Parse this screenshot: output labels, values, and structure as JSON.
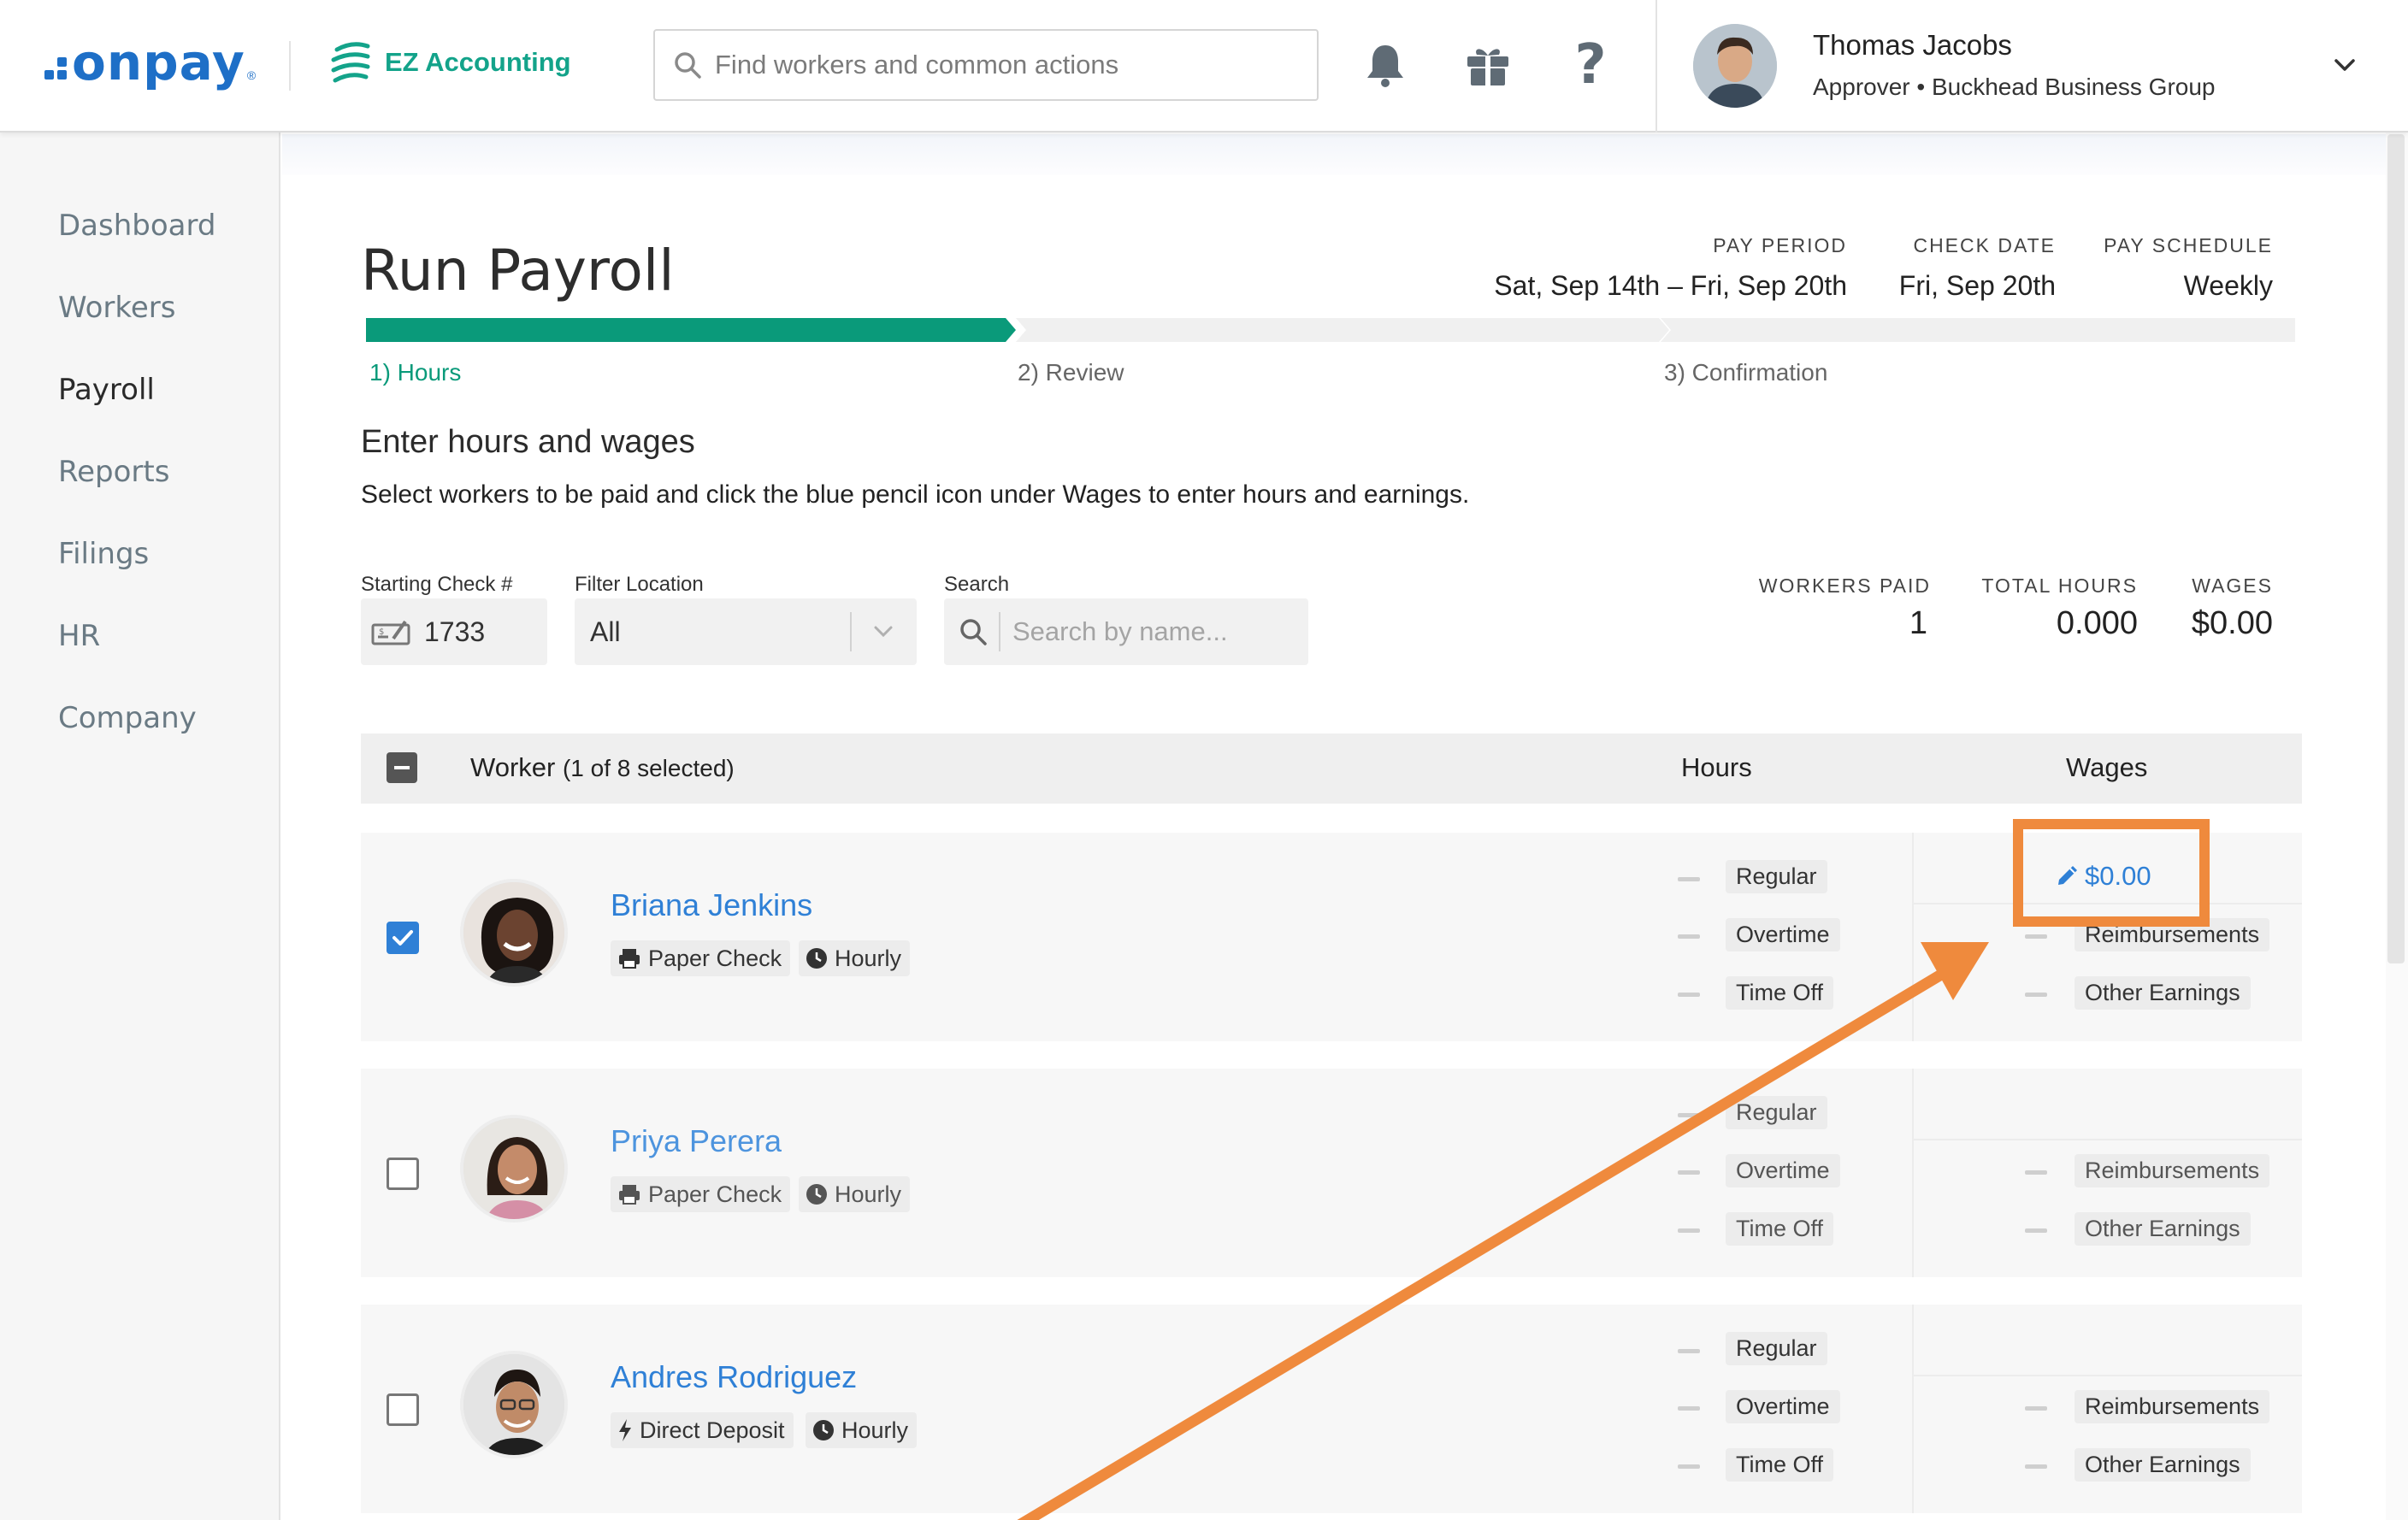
{
  "header": {
    "brand": "onpay",
    "brand_mark": "®",
    "partner": "EZ Accounting",
    "search_placeholder": "Find workers and common actions",
    "icons": [
      "bell-icon",
      "gift-icon",
      "help-icon"
    ],
    "user": {
      "name": "Thomas Jacobs",
      "role": "Approver • Buckhead Business Group"
    }
  },
  "sidebar": {
    "items": [
      {
        "label": "Dashboard",
        "active": false
      },
      {
        "label": "Workers",
        "active": false
      },
      {
        "label": "Payroll",
        "active": true
      },
      {
        "label": "Reports",
        "active": false
      },
      {
        "label": "Filings",
        "active": false
      },
      {
        "label": "HR",
        "active": false
      },
      {
        "label": "Company",
        "active": false
      }
    ]
  },
  "page": {
    "title": "Run Payroll",
    "pay_period": {
      "label": "PAY PERIOD",
      "value": "Sat, Sep 14th – Fri, Sep 20th"
    },
    "check_date": {
      "label": "CHECK DATE",
      "value": "Fri, Sep 20th"
    },
    "pay_schedule": {
      "label": "PAY SCHEDULE",
      "value": "Weekly"
    },
    "steps": [
      {
        "label": "1) Hours",
        "active": true
      },
      {
        "label": "2) Review",
        "active": false
      },
      {
        "label": "3) Confirmation",
        "active": false
      }
    ],
    "section_title": "Enter hours and wages",
    "section_subtitle": "Select workers to be paid and click the blue pencil icon under Wages to enter hours and earnings."
  },
  "filters": {
    "starting_check_label": "Starting Check #",
    "starting_check_value": "1733",
    "location_label": "Filter Location",
    "location_value": "All",
    "search_label": "Search",
    "search_placeholder": "Search by name..."
  },
  "stats": {
    "workers_paid": {
      "label": "WORKERS PAID",
      "value": "1"
    },
    "total_hours": {
      "label": "TOTAL HOURS",
      "value": "0.000"
    },
    "wages": {
      "label": "WAGES",
      "value": "$0.00"
    }
  },
  "table": {
    "worker_header": "Worker",
    "selection": "(1 of 8 selected)",
    "hours_header": "Hours",
    "wages_header": "Wages",
    "hour_types": [
      "Regular",
      "Overtime",
      "Time Off"
    ],
    "wage_types": [
      "Reimbursements",
      "Other Earnings"
    ],
    "rows": [
      {
        "name": "Briana Jenkins",
        "payment": "Paper Check",
        "pay_type": "Hourly",
        "selected": true,
        "wage": "$0.00"
      },
      {
        "name": "Priya Perera",
        "payment": "Paper Check",
        "pay_type": "Hourly",
        "selected": false
      },
      {
        "name": "Andres Rodriguez",
        "payment": "Direct Deposit",
        "pay_type": "Hourly",
        "selected": false
      }
    ]
  },
  "colors": {
    "brand_blue": "#1e6fc7",
    "accent_green": "#0a9a7a",
    "link_blue": "#2f80d6",
    "annotation_orange": "#ef8a3d"
  }
}
